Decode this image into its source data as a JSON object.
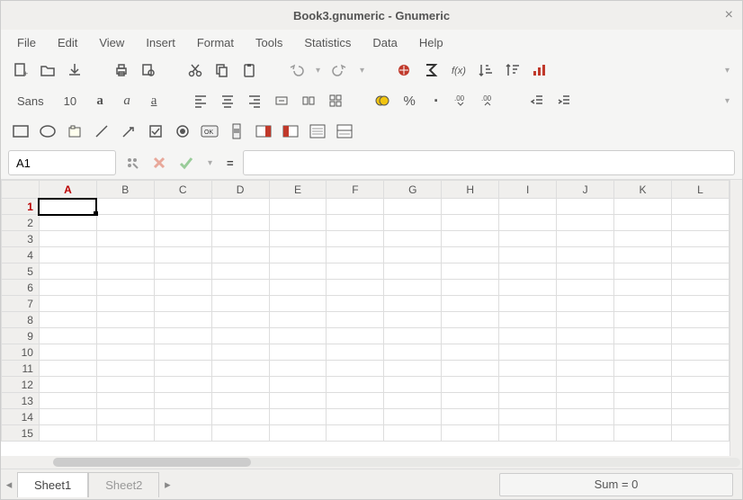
{
  "window": {
    "title": "Book3.gnumeric - Gnumeric"
  },
  "menu": {
    "file": "File",
    "edit": "Edit",
    "view": "View",
    "insert": "Insert",
    "format": "Format",
    "tools": "Tools",
    "statistics": "Statistics",
    "data": "Data",
    "help": "Help"
  },
  "font": {
    "name": "Sans",
    "size": "10"
  },
  "cell_ref": "A1",
  "formula": "",
  "columns": [
    "A",
    "B",
    "C",
    "D",
    "E",
    "F",
    "G",
    "H",
    "I",
    "J",
    "K",
    "L"
  ],
  "rows": [
    "1",
    "2",
    "3",
    "4",
    "5",
    "6",
    "7",
    "8",
    "9",
    "10",
    "11",
    "12",
    "13",
    "14",
    "15"
  ],
  "active_col": 0,
  "active_row": 0,
  "sheets": {
    "s1": "Sheet1",
    "s2": "Sheet2"
  },
  "status": {
    "sum": "Sum = 0"
  }
}
